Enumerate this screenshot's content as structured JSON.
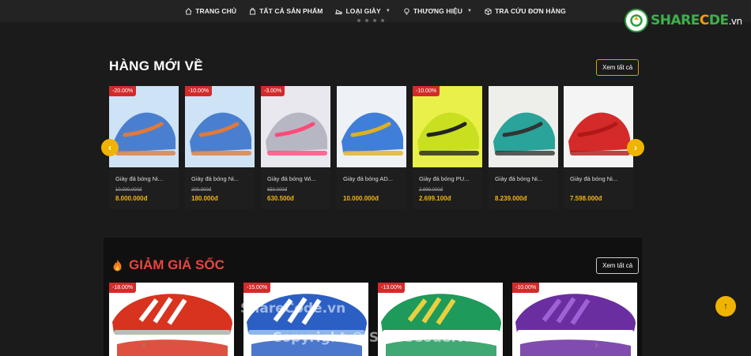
{
  "nav": {
    "items": [
      {
        "label": "TRANG CHỦ",
        "icon": "home-icon"
      },
      {
        "label": "TẤT CẢ SẢN PHẨM",
        "icon": "bag-icon"
      },
      {
        "label": "LOẠI GIÀY",
        "icon": "shoe-icon",
        "dropdown": true
      },
      {
        "label": "THƯƠNG HIỆU",
        "icon": "bulb-icon",
        "dropdown": true
      },
      {
        "label": "TRA CỨU ĐƠN HÀNG",
        "icon": "box-icon"
      }
    ]
  },
  "logo": {
    "part1": "SHARE",
    "part2": "C",
    "part3": "DE",
    "suffix": ".vn"
  },
  "new_arrivals": {
    "title": "HÀNG MỚI VỀ",
    "view_all": "Xem tất cả",
    "products": [
      {
        "badge": "-20.00%",
        "name": "Giày đá bóng Ni...",
        "old_price": "10.000.000đ",
        "price": "8.000.000đ",
        "colors": [
          "#cfe3f7",
          "#4a7fd0",
          "#e07a3a"
        ]
      },
      {
        "badge": "-10.00%",
        "name": "Giày đá bóng Ni...",
        "old_price": "200.000đ",
        "price": "180.000đ",
        "colors": [
          "#cfe3f7",
          "#4a7fd0",
          "#e07a3a"
        ]
      },
      {
        "badge": "-3.00%",
        "name": "Giày đá bóng Wi...",
        "old_price": "650.000đ",
        "price": "630.500đ",
        "colors": [
          "#e8e8ee",
          "#b7b7c4",
          "#ff4a7a"
        ]
      },
      {
        "badge": "",
        "name": "Giày đá bóng AD...",
        "old_price": "",
        "price": "10.000.000đ",
        "colors": [
          "#eef2f6",
          "#3f7fd9",
          "#e0b020"
        ]
      },
      {
        "badge": "-10.00%",
        "name": "Giày đá bóng PU...",
        "old_price": "2.999.000đ",
        "price": "2.699.100đ",
        "colors": [
          "#e9f04a",
          "#c8e020",
          "#222222"
        ]
      },
      {
        "badge": "",
        "name": "Giày đá bóng Ni...",
        "old_price": "",
        "price": "8.239.000đ",
        "colors": [
          "#eeeeea",
          "#2aa39a",
          "#333333"
        ]
      },
      {
        "badge": "",
        "name": "Giày đá bóng Ni...",
        "old_price": "",
        "price": "7.598.000đ",
        "colors": [
          "#f4f4f4",
          "#d42a2a",
          "#b01818"
        ]
      }
    ]
  },
  "flash_sale": {
    "title": "GIẢM GIÁ SỐC",
    "view_all": "Xem tất cả",
    "products": [
      {
        "badge": "-18.00%",
        "colors": [
          "#d8331f",
          "#ffffff",
          "#bbbbbb"
        ]
      },
      {
        "badge": "-15.00%",
        "colors": [
          "#2c5fc4",
          "#ffffff",
          "#8fb6e8"
        ]
      },
      {
        "badge": "-13.00%",
        "colors": [
          "#1e9a5a",
          "#e8d040",
          "#ffffff"
        ]
      },
      {
        "badge": "-10.00%",
        "colors": [
          "#6a2ea0",
          "#a060d8",
          "#ffffff"
        ]
      }
    ]
  },
  "watermark": {
    "top": "ShareCode.vn",
    "bottom": "Copyright © ShareCode.vn"
  },
  "colors": {
    "accent": "#f0b400",
    "sale_red": "#d42a2a",
    "price_gold": "#f5b50a"
  }
}
